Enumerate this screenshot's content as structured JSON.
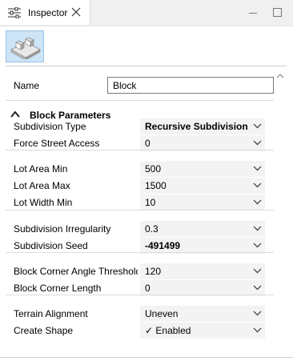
{
  "tab": {
    "title": "Inspector",
    "icon": "sliders-icon"
  },
  "window_controls": {
    "minimize": "minimize-icon",
    "maximize": "maximize-icon"
  },
  "thumbnail": {
    "icon": "block-shape-icon"
  },
  "name_field": {
    "label": "Name",
    "value": "Block"
  },
  "section": {
    "title": "Block Parameters",
    "icon": "chevron-up-icon"
  },
  "groups": [
    {
      "props": [
        {
          "label": "Subdivision Type",
          "value": "Recursive Subdivision",
          "bold": true
        },
        {
          "label": "Force Street Access",
          "value": "0",
          "bold": false
        }
      ]
    },
    {
      "props": [
        {
          "label": "Lot Area Min",
          "value": "500",
          "bold": false
        },
        {
          "label": "Lot Area Max",
          "value": "1500",
          "bold": false
        },
        {
          "label": "Lot Width Min",
          "value": "10",
          "bold": false
        }
      ]
    },
    {
      "props": [
        {
          "label": "Subdivision Irregularity",
          "value": "0.3",
          "bold": false
        },
        {
          "label": "Subdivision Seed",
          "value": "-491499",
          "bold": true
        }
      ]
    },
    {
      "props": [
        {
          "label": "Block Corner Angle Threshold",
          "value": "120",
          "bold": false
        },
        {
          "label": "Block Corner Length",
          "value": "0",
          "bold": false
        }
      ]
    },
    {
      "props": [
        {
          "label": "Terrain Alignment",
          "value": "Uneven",
          "bold": false
        },
        {
          "label": "Create Shape",
          "value": "✓ Enabled",
          "bold": false
        }
      ]
    }
  ],
  "colors": {
    "thumbnail_bg": "#cde4f7",
    "field_bg": "#f3f3f3"
  }
}
